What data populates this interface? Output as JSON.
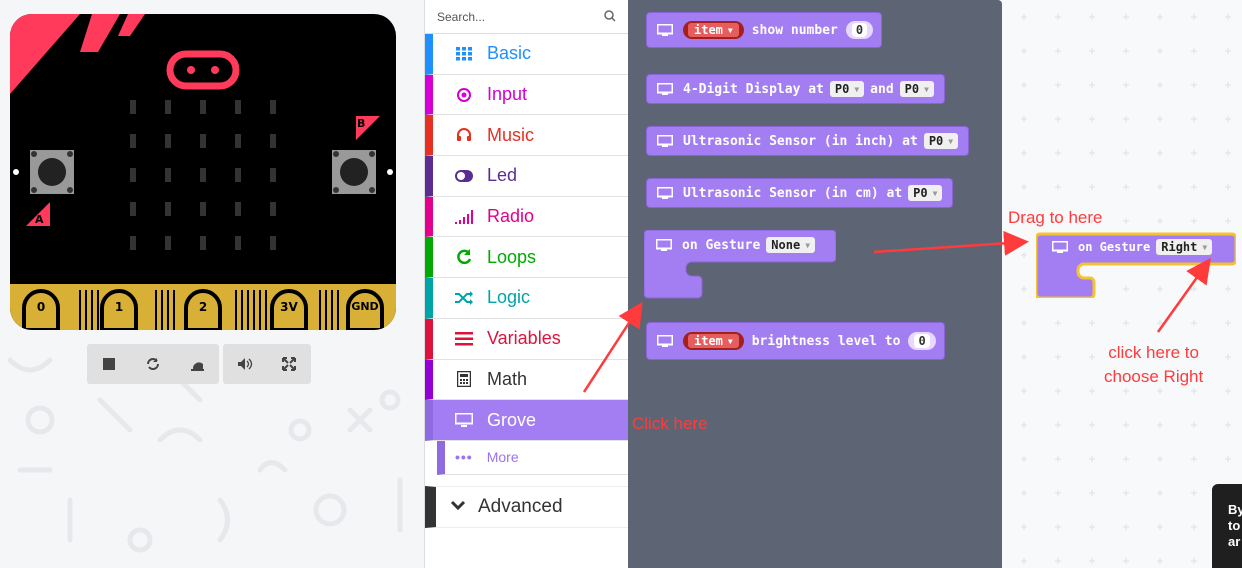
{
  "simulator": {
    "pins": [
      "0",
      "1",
      "2",
      "3V",
      "GND"
    ],
    "button_a": "A",
    "button_b": "B",
    "toolbar": {
      "stop_icon": "stop-icon",
      "restart_icon": "restart-icon",
      "slowmo_icon": "snail-icon",
      "mute_icon": "speaker-icon",
      "fullscreen_icon": "expand-icon"
    }
  },
  "toolbox": {
    "search_placeholder": "Search...",
    "categories": [
      {
        "label": "Basic",
        "icon": "grid-icon",
        "color": "#1e90ff"
      },
      {
        "label": "Input",
        "icon": "target-icon",
        "color": "#d400d4"
      },
      {
        "label": "Music",
        "icon": "headphones-icon",
        "color": "#e63022"
      },
      {
        "label": "Led",
        "icon": "toggle-icon",
        "color": "#5c2d91"
      },
      {
        "label": "Radio",
        "icon": "signal-icon",
        "color": "#e3008c"
      },
      {
        "label": "Loops",
        "icon": "loop-icon",
        "color": "#00aa00"
      },
      {
        "label": "Logic",
        "icon": "shuffle-icon",
        "color": "#00a4a6"
      },
      {
        "label": "Variables",
        "icon": "lines-icon",
        "color": "#dc143c"
      },
      {
        "label": "Math",
        "icon": "calculator-icon",
        "color": "#9400d3"
      },
      {
        "label": "Grove",
        "icon": "monitor-icon",
        "color": "#a37ef2"
      }
    ],
    "more_label": "More",
    "advanced_label": "Advanced"
  },
  "flyout": {
    "blocks": [
      {
        "item": "item",
        "text": "show number",
        "value": "0"
      },
      {
        "text": "4-Digit Display at",
        "dd1": "P0",
        "and": "and",
        "dd2": "P0"
      },
      {
        "text": "Ultrasonic Sensor (in inch) at",
        "dd": "P0"
      },
      {
        "text": "Ultrasonic Sensor (in cm) at",
        "dd": "P0"
      },
      {
        "text": "on Gesture",
        "dd": "None"
      },
      {
        "item": "item",
        "text": "brightness level to",
        "value": "0"
      }
    ]
  },
  "workspace": {
    "block": {
      "text": "on Gesture",
      "dd": "Right"
    },
    "hint_text": "By\nto\nar"
  },
  "annotations": {
    "click_here": "Click here",
    "drag_to_here": "Drag to here",
    "choose_right": "click here to\nchoose Right",
    "color": "#ff3b3b"
  }
}
